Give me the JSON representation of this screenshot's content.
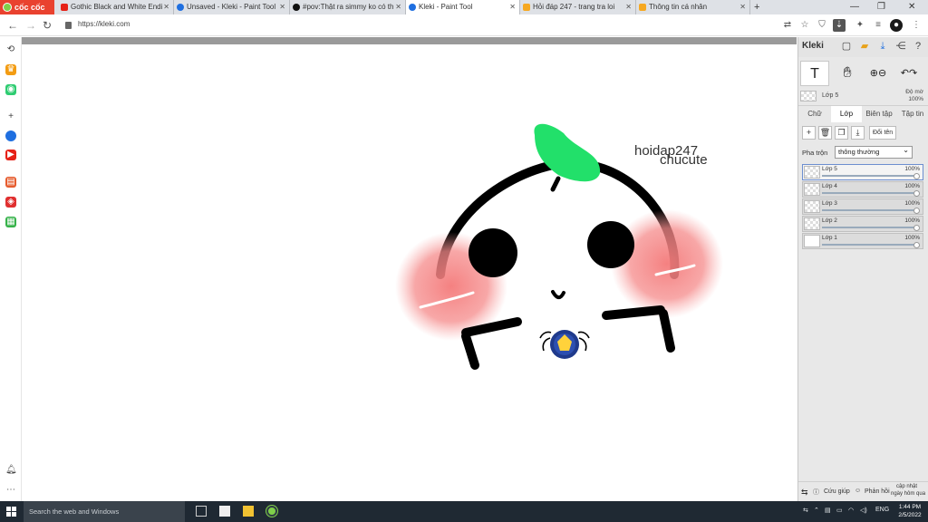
{
  "browser": {
    "brand": "cốc cốc",
    "tabs": [
      {
        "title": "Gothic Black and White Endi",
        "icon": "youtube-icon",
        "active": false
      },
      {
        "title": "Unsaved - Kleki - Paint Tool",
        "icon": "kleki-icon",
        "active": false
      },
      {
        "title": "#pov:Thật ra simmy ko có th",
        "icon": "tiktok-icon",
        "active": false
      },
      {
        "title": "Kleki - Paint Tool",
        "icon": "kleki-icon",
        "active": true
      },
      {
        "title": "Hỏi đáp 247 - trang tra loi",
        "icon": "hoidap-icon",
        "active": false
      },
      {
        "title": "Thông tin cá nhân",
        "icon": "hoidap-icon",
        "active": false
      }
    ],
    "url": "https://kleki.com"
  },
  "canvas": {
    "watermark_line1": "hoidap247",
    "watermark_line2": "chucute"
  },
  "kleki": {
    "logo": "Kleki",
    "current_layer": "Lớp 5",
    "opacity_label": "Độ mờ",
    "opacity_value": "100%",
    "tabs": [
      "Chữ",
      "Lớp",
      "Biên tập",
      "Tập tin"
    ],
    "active_tab": "Lớp",
    "rename_label": "Đổi tên",
    "blend_label": "Pha trộn",
    "blend_value": "thông thường",
    "layers": [
      {
        "name": "Lớp 5",
        "opacity": "100%",
        "active": true
      },
      {
        "name": "Lớp 4",
        "opacity": "100%",
        "active": false
      },
      {
        "name": "Lớp 3",
        "opacity": "100%",
        "active": false
      },
      {
        "name": "Lớp 2",
        "opacity": "100%",
        "active": false
      },
      {
        "name": "Lớp 1",
        "opacity": "100%",
        "active": false
      }
    ],
    "help_label": "Cứu giúp",
    "feedback_label": "Phản hồi",
    "update_label_1": "cập nhật",
    "update_label_2": "ngày hôm qua"
  },
  "taskbar": {
    "search_placeholder": "Search the web and Windows",
    "language": "ENG",
    "time": "1:44 PM",
    "date": "2/5/2022"
  },
  "colors": {
    "brand": "#e9422f",
    "blush": "#f47a7a",
    "leaf": "#22e06a",
    "stroke": "#000000"
  }
}
